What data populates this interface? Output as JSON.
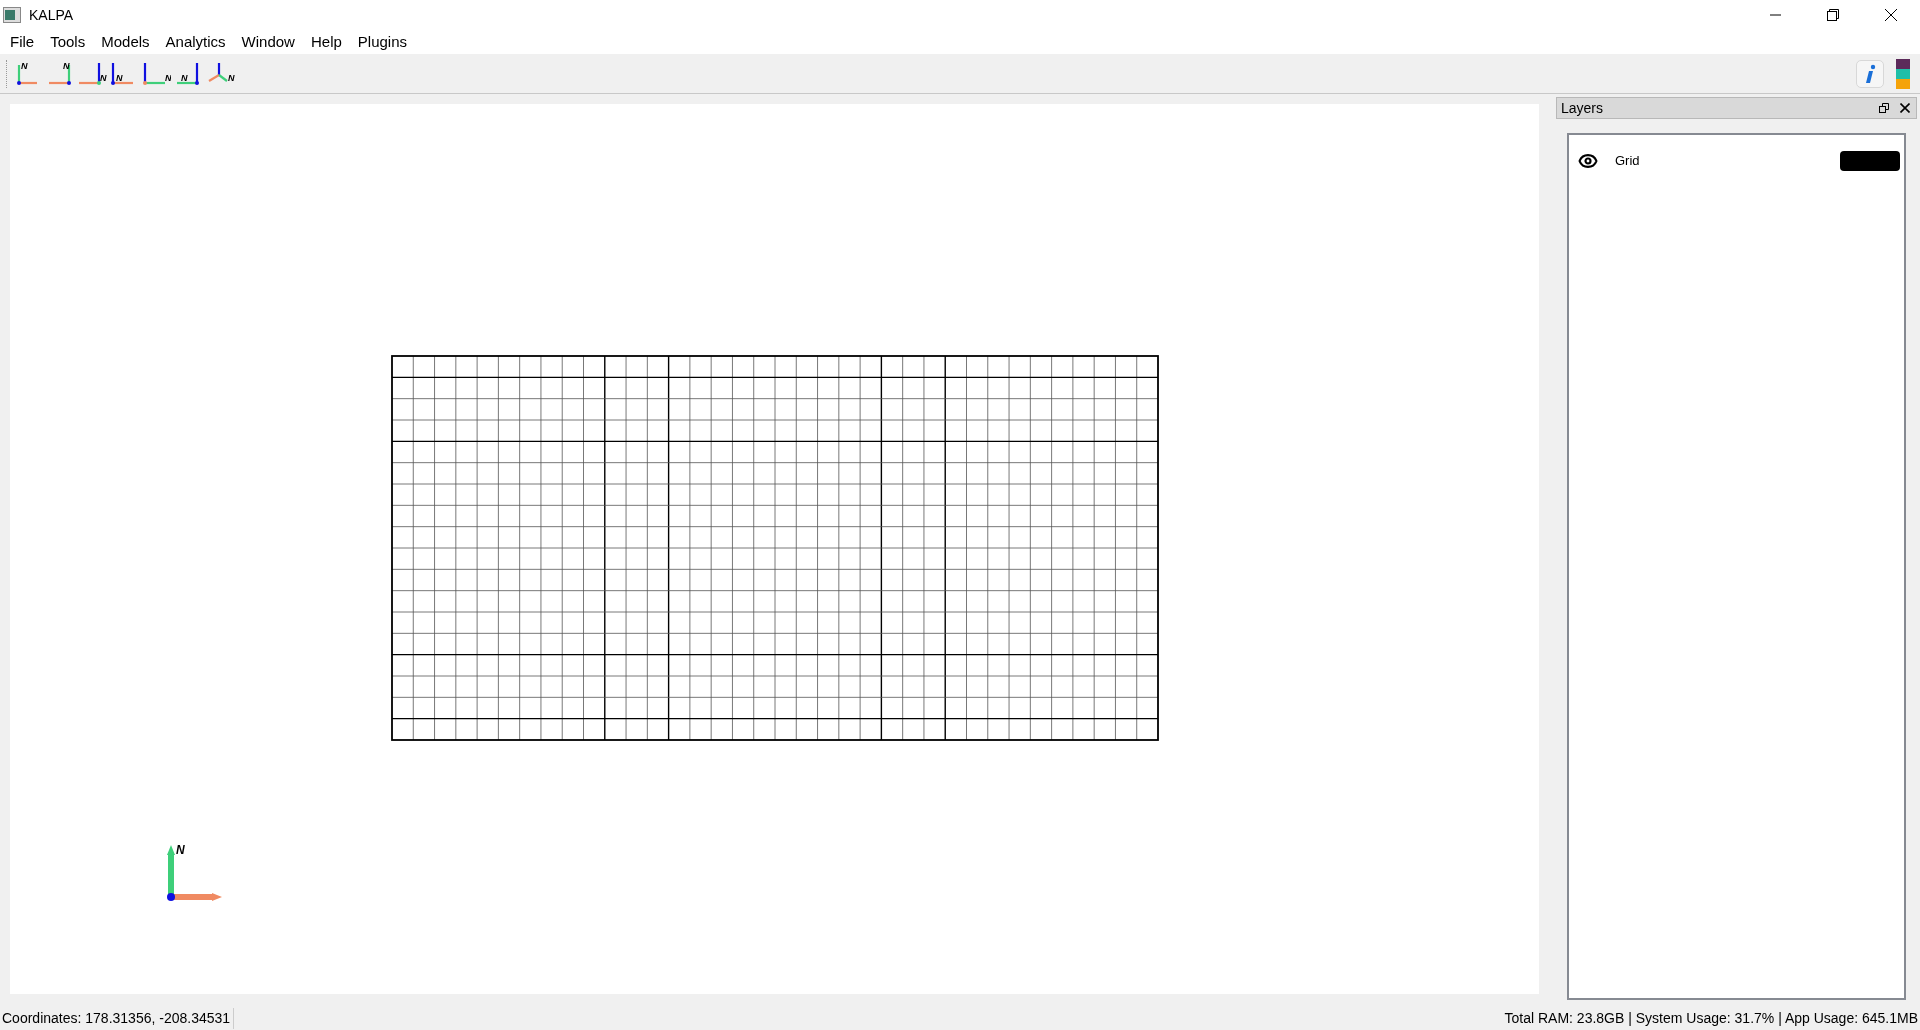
{
  "window": {
    "title": "KALPA"
  },
  "menu": [
    "File",
    "Tools",
    "Models",
    "Analytics",
    "Window",
    "Help",
    "Plugins"
  ],
  "toolbar": {
    "views": [
      {
        "kind": "front",
        "label": "N"
      },
      {
        "kind": "back",
        "label": "N"
      },
      {
        "kind": "left",
        "label": "N"
      },
      {
        "kind": "right",
        "label": "N"
      },
      {
        "kind": "top",
        "label": "N"
      },
      {
        "kind": "bottom",
        "label": "N"
      },
      {
        "kind": "iso",
        "label": "N"
      }
    ]
  },
  "compass": {
    "label": "N"
  },
  "layers_panel": {
    "title": "Layers",
    "layers": [
      {
        "name": "Grid",
        "visible": true,
        "color": "#000000"
      }
    ]
  },
  "status_bar": {
    "coordinates": "Coordinates: 178.31356, -208.34531",
    "system": "Total RAM: 23.8GB | System Usage: 31.7% | App Usage: 645.1MB"
  }
}
